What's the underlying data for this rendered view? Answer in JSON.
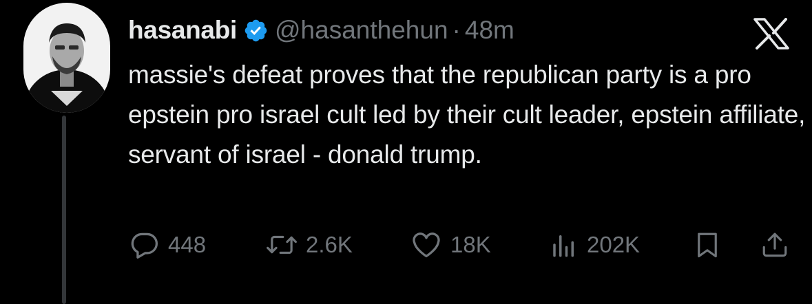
{
  "tweet": {
    "display_name": "hasanabi",
    "handle": "@hasanthehun",
    "separator": "·",
    "time": "48m",
    "text": "massie's defeat proves that the republican party is a pro epstein pro israel cult led by their cult leader, epstein affiliate, servant of israel - donald trump."
  },
  "stats": {
    "replies": "448",
    "retweets": "2.6K",
    "likes": "18K",
    "views": "202K"
  },
  "icons": {
    "verified": "verified-badge-icon",
    "logo": "x-logo-icon",
    "reply": "reply-icon",
    "retweet": "retweet-icon",
    "like": "heart-icon",
    "views": "views-icon",
    "bookmark": "bookmark-icon",
    "share": "share-icon"
  },
  "colors": {
    "background": "#000000",
    "text": "#e7e9ea",
    "secondary": "#71767b",
    "verified": "#1d9bf0"
  }
}
